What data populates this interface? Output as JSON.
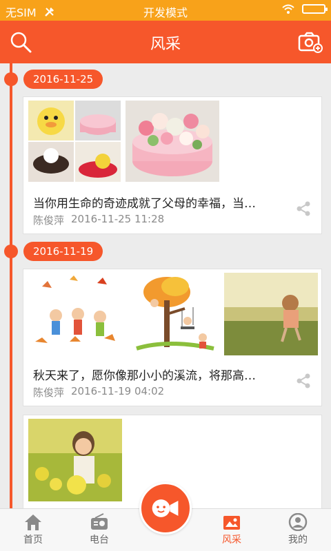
{
  "status_bar": {
    "carrier": "无SIM",
    "mode": "开发模式"
  },
  "header": {
    "title": "风采"
  },
  "posts": [
    {
      "date": "2016-11-25",
      "title": "当你用生命的奇迹成就了父母的幸福，当…",
      "author": "陈俊萍",
      "time": "2016-11-25 11:28"
    },
    {
      "date": "2016-11-19",
      "title": "秋天来了，愿你像那小小的溪流，将那高…",
      "author": "陈俊萍",
      "time": "2016-11-19 04:02"
    }
  ],
  "tabs": [
    {
      "label": "首页",
      "icon": "home-icon"
    },
    {
      "label": "电台",
      "icon": "radio-icon"
    },
    {
      "label": "风采",
      "icon": "photos-icon",
      "active": true
    },
    {
      "label": "我的",
      "icon": "profile-icon"
    }
  ],
  "colors": {
    "accent": "#f6572b",
    "status_bar": "#f8a21a"
  }
}
